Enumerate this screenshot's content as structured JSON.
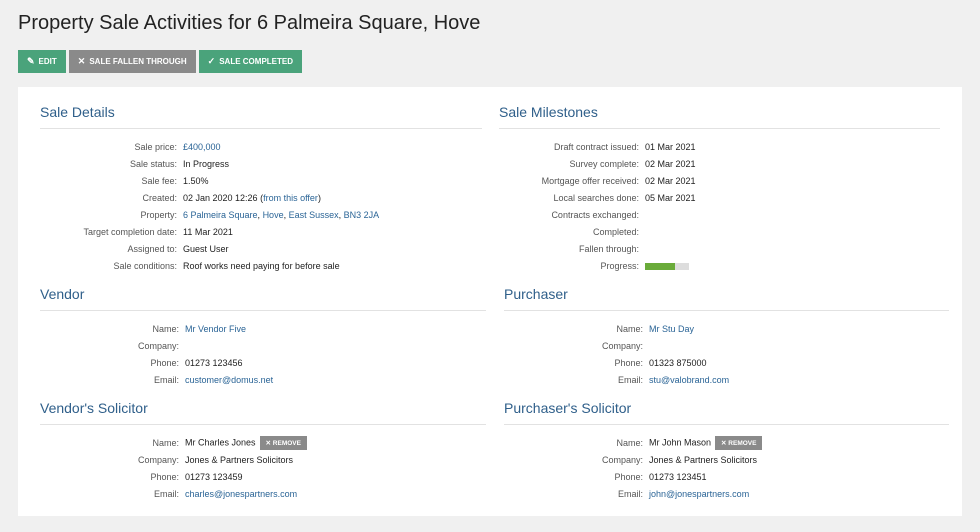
{
  "page": {
    "title": "Property Sale Activities for 6 Palmeira Square, Hove"
  },
  "toolbar": {
    "edit_label": "EDIT",
    "fallen_label": "SALE FALLEN THROUGH",
    "completed_label": "SALE COMPLETED"
  },
  "sale_details": {
    "heading": "Sale Details",
    "sale_price_label": "Sale price:",
    "sale_price": "£400,000",
    "sale_status_label": "Sale status:",
    "sale_status": "In Progress",
    "sale_fee_label": "Sale fee:",
    "sale_fee": "1.50%",
    "created_label": "Created:",
    "created": "02 Jan 2020 12:26",
    "created_paren_open": " (",
    "created_link": "from this offer",
    "created_paren_close": ")",
    "property_label": "Property:",
    "property_parts": [
      "6 Palmeira Square",
      "Hove",
      "East Sussex",
      "BN3 2JA"
    ],
    "property_sep": ", ",
    "target_label": "Target completion date:",
    "target": "11 Mar 2021",
    "assigned_label": "Assigned to:",
    "assigned": "Guest User",
    "conditions_label": "Sale conditions:",
    "conditions": "Roof works need paying for before sale"
  },
  "milestones": {
    "heading": "Sale Milestones",
    "draft_label": "Draft contract issued:",
    "draft": "01 Mar 2021",
    "survey_label": "Survey complete:",
    "survey": "02 Mar 2021",
    "mortgage_label": "Mortgage offer received:",
    "mortgage": "02 Mar 2021",
    "searches_label": "Local searches done:",
    "searches": "05 Mar 2021",
    "contracts_label": "Contracts exchanged:",
    "contracts": "",
    "completed_label": "Completed:",
    "completed": "",
    "fallen_label": "Fallen through:",
    "fallen": "",
    "progress_label": "Progress:",
    "progress": 0.68,
    "progress_color": "#6aab3a"
  },
  "vendor": {
    "heading": "Vendor",
    "name_label": "Name:",
    "name": "Mr Vendor Five",
    "company_label": "Company:",
    "company": "",
    "phone_label": "Phone:",
    "phone": "01273 123456",
    "email_label": "Email:",
    "email": "customer@domus.net"
  },
  "purchaser": {
    "heading": "Purchaser",
    "name_label": "Name:",
    "name": "Mr Stu Day",
    "company_label": "Company:",
    "company": "",
    "phone_label": "Phone:",
    "phone": "01323 875000",
    "email_label": "Email:",
    "email": "stu@valobrand.com"
  },
  "vendor_solicitor": {
    "heading": "Vendor's Solicitor",
    "name_label": "Name:",
    "name": "Mr Charles Jones",
    "remove_label": "REMOVE",
    "company_label": "Company:",
    "company": "Jones & Partners Solicitors",
    "phone_label": "Phone:",
    "phone": "01273 123459",
    "email_label": "Email:",
    "email": "charles@jonespartners.com"
  },
  "purchaser_solicitor": {
    "heading": "Purchaser's Solicitor",
    "name_label": "Name:",
    "name": "Mr John Mason",
    "remove_label": "REMOVE",
    "company_label": "Company:",
    "company": "Jones & Partners Solicitors",
    "phone_label": "Phone:",
    "phone": "01273 123451",
    "email_label": "Email:",
    "email": "john@jonespartners.com"
  },
  "colors": {
    "accent_green": "#4aa37b",
    "heading_blue": "#2f5f8a",
    "link_blue": "#2a6496",
    "grey_button": "#8a8a8a"
  }
}
